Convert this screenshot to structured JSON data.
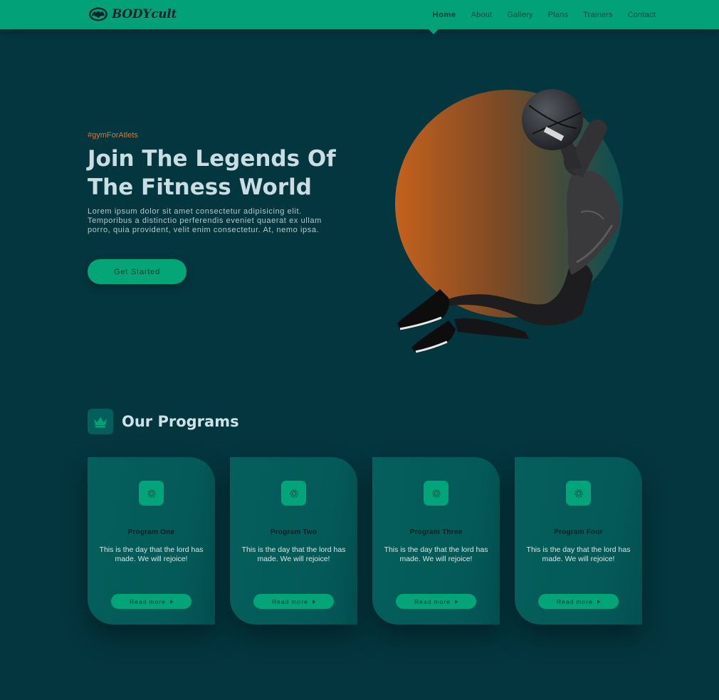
{
  "brand": {
    "name": "BODYcult",
    "logo_icon": "muscle-icon"
  },
  "nav": {
    "items": [
      {
        "label": "Home",
        "active": true
      },
      {
        "label": "About"
      },
      {
        "label": "Gallery"
      },
      {
        "label": "Plans"
      },
      {
        "label": "Trainers"
      },
      {
        "label": "Contact"
      }
    ]
  },
  "hero": {
    "tag": "#gymForAtlets",
    "title": "Join The Legends Of The Fitness World",
    "text": "Lorem ipsum dolor sit amet consectetur adipisicing elit. Temporibus a distinctio perferendis eveniet quaerat ex ullam porro, quia provident, velit enim consectetur. At, nemo ipsa.",
    "button_label": "Get Started",
    "image": "athlete-with-medicine-ball"
  },
  "programs": {
    "section_icon": "crown-icon",
    "title": "Our Programs",
    "cards": [
      {
        "title": "Program One",
        "description": "This is the day that the lord has made. We will rejoice!",
        "button_label": "Read more",
        "icon": "gear-icon"
      },
      {
        "title": "Program Two",
        "description": "This is the day that the lord has made. We will rejoice!",
        "button_label": "Read more",
        "icon": "gear-icon"
      },
      {
        "title": "Program Three",
        "description": "This is the day that the lord has made. We will rejoice!",
        "button_label": "Read more",
        "icon": "gear-icon"
      },
      {
        "title": "Program Four",
        "description": "This is the day that the lord has made. We will rejoice!",
        "button_label": "Read more",
        "icon": "gear-icon"
      }
    ]
  },
  "colors": {
    "background": "#04363f",
    "accent": "#03a177",
    "card": "#055f5c",
    "hero_circle_orange": "#c2601f"
  }
}
